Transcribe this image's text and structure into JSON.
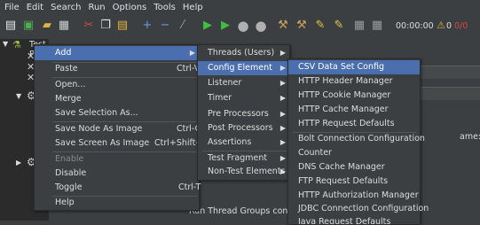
{
  "menubar": [
    "File",
    "Edit",
    "Search",
    "Run",
    "Options",
    "Tools",
    "Help"
  ],
  "toolbar": {
    "timer": "00:00:00",
    "warnings": "0",
    "errors": "0/0"
  },
  "tree": {
    "root": "Test Plan"
  },
  "right_pane": {
    "name_label": "ame:",
    "run_thread_groups_text": "Run Thread Groups consecu"
  },
  "context_menu": {
    "items": [
      {
        "label": "Add",
        "shortcut": ""
      },
      {
        "label": "Paste",
        "shortcut": "Ctrl-V"
      },
      {
        "label": "Open...",
        "shortcut": ""
      },
      {
        "label": "Merge",
        "shortcut": ""
      },
      {
        "label": "Save Selection As...",
        "shortcut": ""
      },
      {
        "label": "Save Node As Image",
        "shortcut": "Ctrl-G"
      },
      {
        "label": "Save Screen As Image",
        "shortcut": "Ctrl+Shift-G"
      },
      {
        "label": "Enable",
        "shortcut": ""
      },
      {
        "label": "Disable",
        "shortcut": ""
      },
      {
        "label": "Toggle",
        "shortcut": "Ctrl-T"
      },
      {
        "label": "Help",
        "shortcut": ""
      }
    ]
  },
  "add_submenu": {
    "items": [
      "Threads (Users)",
      "Config Element",
      "Listener",
      "Timer",
      "Pre Processors",
      "Post Processors",
      "Assertions",
      "Test Fragment",
      "Non-Test Elements"
    ]
  },
  "config_submenu": {
    "items": [
      "CSV Data Set Config",
      "HTTP Header Manager",
      "HTTP Cookie Manager",
      "HTTP Cache Manager",
      "HTTP Request Defaults",
      "Bolt Connection Configuration",
      "Counter",
      "DNS Cache Manager",
      "FTP Request Defaults",
      "HTTP Authorization Manager",
      "JDBC Connection Configuration",
      "Java Request Defaults"
    ]
  }
}
